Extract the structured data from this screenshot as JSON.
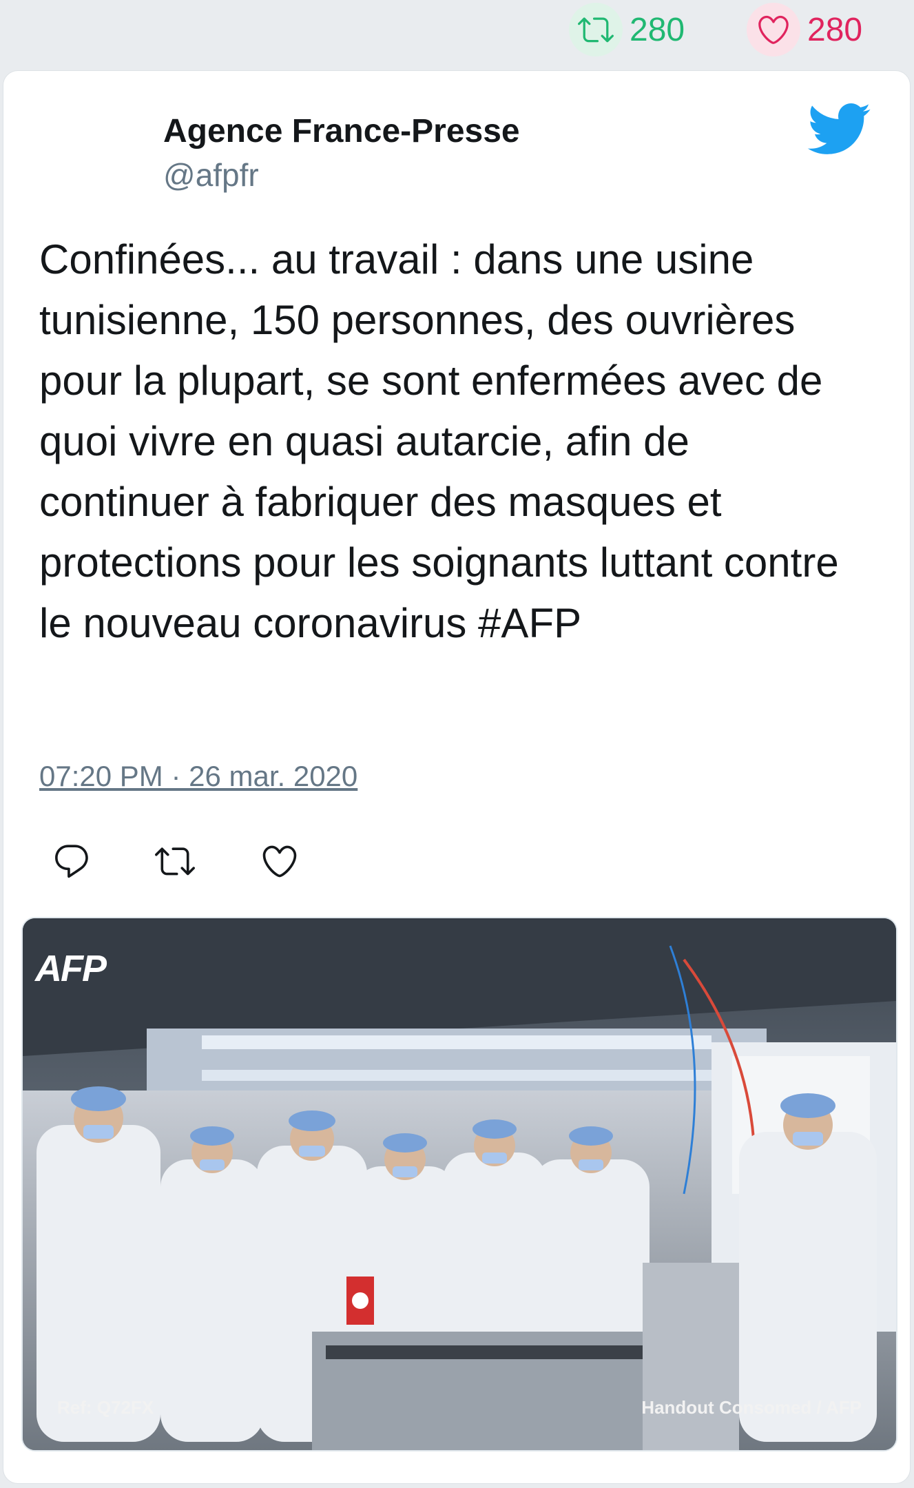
{
  "stats": {
    "retweets": "280",
    "likes": "280",
    "retweet_color": "#20b872",
    "like_color": "#e0245e"
  },
  "author": {
    "name": "Agence France-Presse",
    "handle": "@afpfr"
  },
  "tweet": {
    "text": "Confinées... au travail : dans une usine tunisienne, 150 personnes, des ouvrières pour la plupart, se sont enfermées avec de quoi vivre en quasi autarcie, afin de continuer à fabriquer des masques et protections pour les soignants luttant contre le nouveau coronavirus #AFP",
    "timestamp": "07:20 PM · 26 mar. 2020"
  },
  "actions": {
    "icons": [
      "reply-icon",
      "retweet-icon",
      "like-icon"
    ]
  },
  "media": {
    "watermark": "AFP",
    "ref": "Ref: Q72FX",
    "credit": "Handout Consomed / AFP"
  },
  "brand": {
    "twitter_color": "#1da1f2"
  }
}
